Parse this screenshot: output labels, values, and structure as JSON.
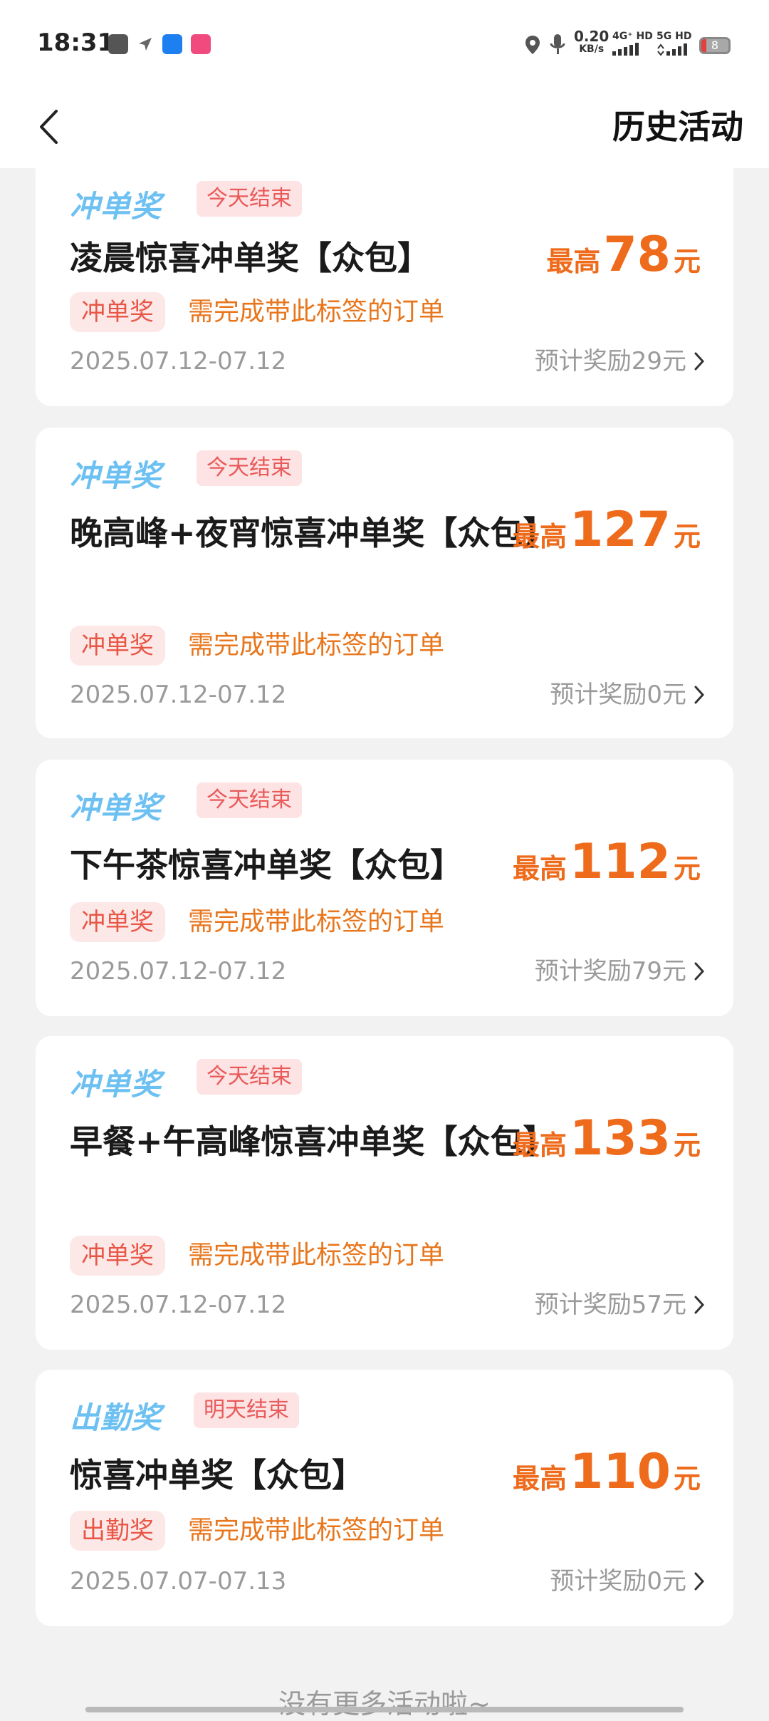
{
  "status_bar": {
    "time": "18:31",
    "net_speed": "0.20",
    "net_unit": "KB/s",
    "sig1": "4G⁺ HD",
    "sig2": "5G HD",
    "battery": "8"
  },
  "header": {
    "title": "历史活动"
  },
  "cards": [
    {
      "tag": "冲单奖",
      "end_label": "今天结束",
      "title": "凌晨惊喜冲单奖【众包】",
      "reward_prefix": "最高",
      "reward_value": "78",
      "reward_unit": "元",
      "chip": "冲单奖",
      "requirement": "需完成带此标签的订单",
      "date": "2025.07.12-07.12",
      "estimate": "预计奖励29元"
    },
    {
      "tag": "冲单奖",
      "end_label": "今天结束",
      "title": "晚高峰+夜宵惊喜冲单奖【众包】",
      "reward_prefix": "最高",
      "reward_value": "127",
      "reward_unit": "元",
      "chip": "冲单奖",
      "requirement": "需完成带此标签的订单",
      "date": "2025.07.12-07.12",
      "estimate": "预计奖励0元"
    },
    {
      "tag": "冲单奖",
      "end_label": "今天结束",
      "title": "下午茶惊喜冲单奖【众包】",
      "reward_prefix": "最高",
      "reward_value": "112",
      "reward_unit": "元",
      "chip": "冲单奖",
      "requirement": "需完成带此标签的订单",
      "date": "2025.07.12-07.12",
      "estimate": "预计奖励79元"
    },
    {
      "tag": "冲单奖",
      "end_label": "今天结束",
      "title": "早餐+午高峰惊喜冲单奖【众包】",
      "reward_prefix": "最高",
      "reward_value": "133",
      "reward_unit": "元",
      "chip": "冲单奖",
      "requirement": "需完成带此标签的订单",
      "date": "2025.07.12-07.12",
      "estimate": "预计奖励57元"
    },
    {
      "tag": "出勤奖",
      "end_label": "明天结束",
      "title": "惊喜冲单奖【众包】",
      "reward_prefix": "最高",
      "reward_value": "110",
      "reward_unit": "元",
      "chip": "出勤奖",
      "requirement": "需完成带此标签的订单",
      "date": "2025.07.07-07.13",
      "estimate": "预计奖励0元"
    }
  ],
  "footer": {
    "text": "没有更多活动啦~"
  },
  "colors": {
    "accent": "#ef6b1c",
    "tag_blue": "#6cc0f2",
    "badge_bg": "#fde3e3",
    "badge_text": "#e95a5a"
  }
}
